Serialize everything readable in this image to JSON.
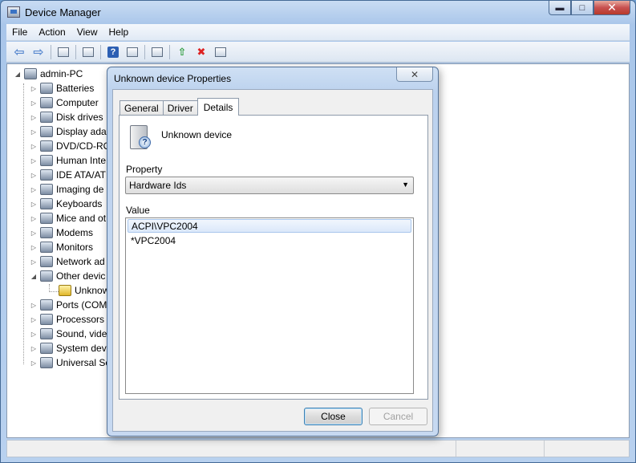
{
  "window": {
    "title": "Device Manager",
    "minimize": "▬",
    "maximize": "□",
    "close": "✕"
  },
  "menu": [
    "File",
    "Action",
    "View",
    "Help"
  ],
  "tree": {
    "root": "admin-PC",
    "categories": [
      "Batteries",
      "Computer",
      "Disk drives",
      "Display ada",
      "DVD/CD-RO",
      "Human Inte",
      "IDE ATA/AT",
      "Imaging de",
      "Keyboards",
      "Mice and ot",
      "Modems",
      "Monitors",
      "Network ad",
      "Other devic",
      "Unknow",
      "Ports (COM",
      "Processors",
      "Sound, vide",
      "System dev",
      "Universal Se"
    ]
  },
  "dialog": {
    "title": "Unknown device Properties",
    "close_glyph": "✕",
    "tabs": [
      "General",
      "Driver",
      "Details"
    ],
    "device_name": "Unknown device",
    "property_label": "Property",
    "property_value": "Hardware Ids",
    "value_label": "Value",
    "values": [
      "ACPI\\VPC2004",
      "*VPC2004"
    ],
    "close_button": "Close",
    "cancel_button": "Cancel"
  }
}
